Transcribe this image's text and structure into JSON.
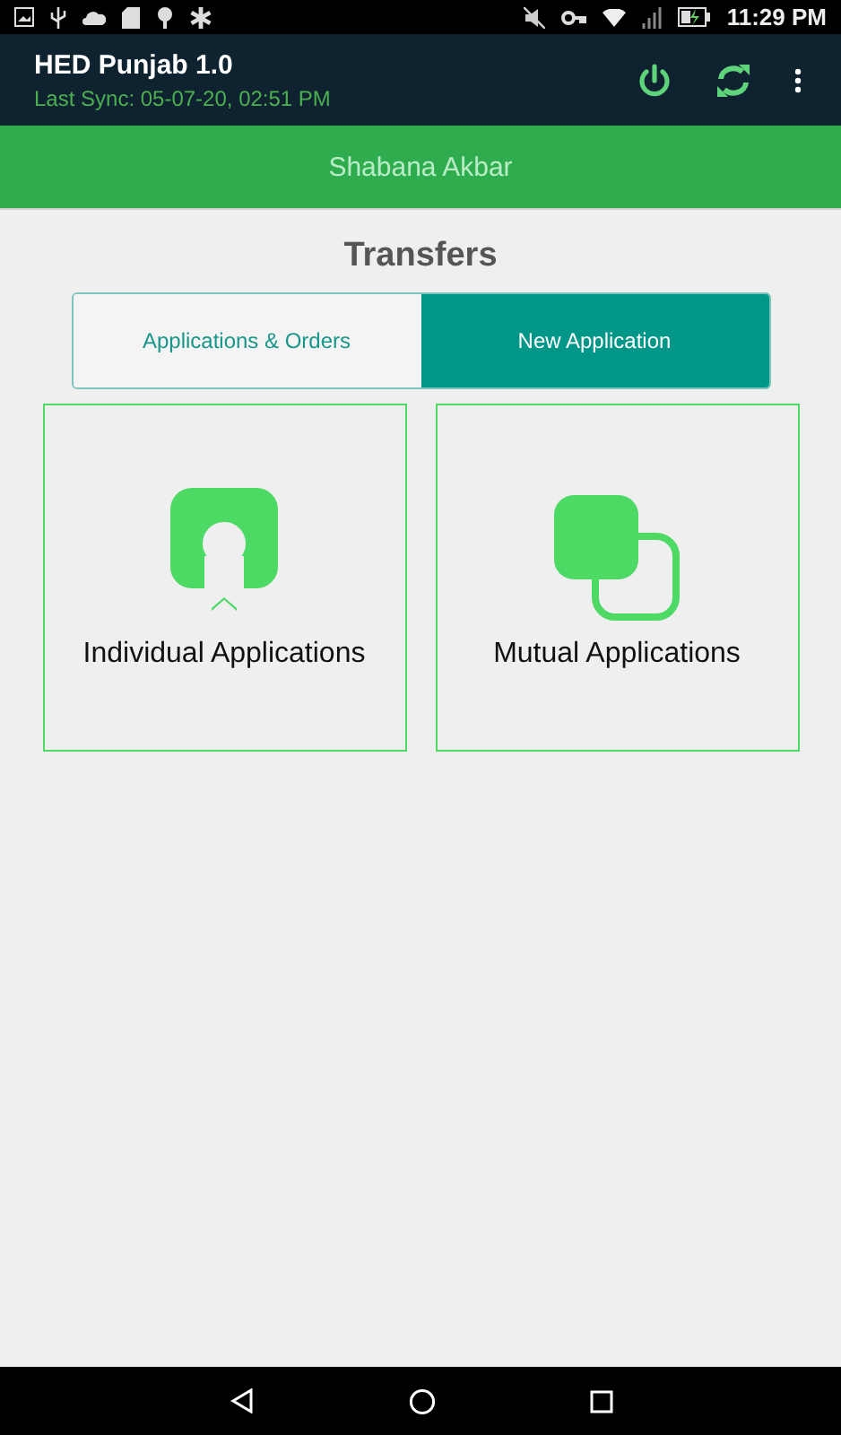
{
  "status_bar": {
    "time": "11:29 PM"
  },
  "app_bar": {
    "title": "HED Punjab 1.0",
    "subtitle": "Last Sync: 05-07-20, 02:51 PM"
  },
  "user": {
    "name": "Shabana Akbar"
  },
  "section": {
    "title": "Transfers"
  },
  "tabs": [
    {
      "label": "Applications & Orders",
      "selected": false
    },
    {
      "label": "New Application",
      "selected": true
    }
  ],
  "cards": [
    {
      "kind": "individual",
      "label": "Individual Applications"
    },
    {
      "kind": "mutual",
      "label": "Mutual Applications"
    }
  ]
}
